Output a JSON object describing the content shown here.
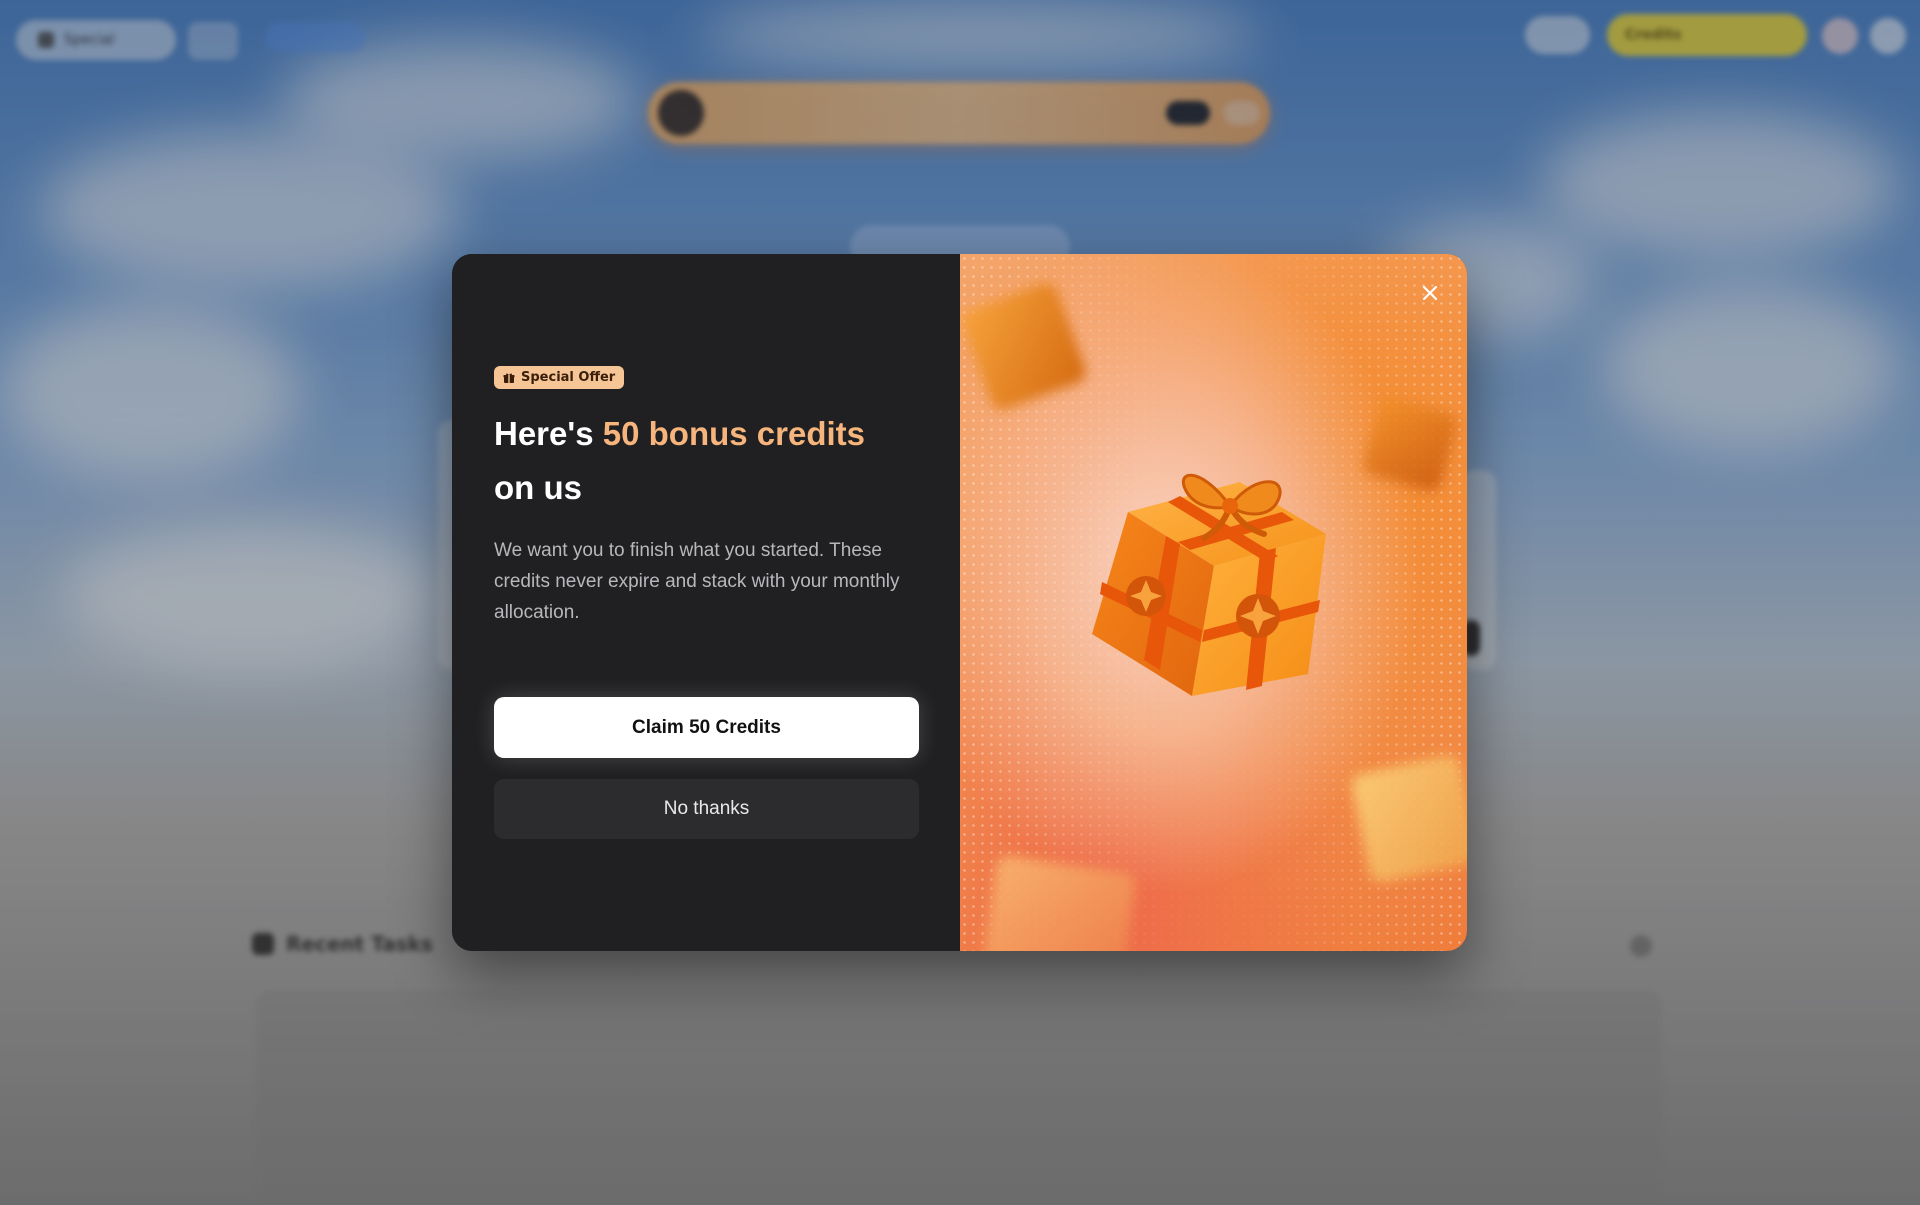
{
  "background": {
    "top_left_label": "Special",
    "credits_pill": {
      "label": "Credits",
      "value": ""
    },
    "banner": {
      "text": "",
      "primary_label": "",
      "secondary_label": ""
    },
    "tasks": {
      "title": "Recent Tasks",
      "subtitle": ""
    }
  },
  "modal": {
    "badge": {
      "icon": "gift-icon",
      "label": "Special Offer"
    },
    "headline": {
      "prefix": "Here's ",
      "accent": "50 bonus credits",
      "suffix": "on us"
    },
    "description": "We want you to finish what you started. These credits never expire and stack with your monthly allocation.",
    "primary_button": "Claim 50 Credits",
    "secondary_button": "No thanks",
    "close_icon": "close-icon",
    "illustration": "gift-box-illustration"
  },
  "colors": {
    "accent_orange": "#f6b57c",
    "badge_bg": "#f6c596",
    "modal_bg": "#202022",
    "secondary_button_bg": "#2c2c2f",
    "credits_yellow": "#f2dc3a"
  }
}
